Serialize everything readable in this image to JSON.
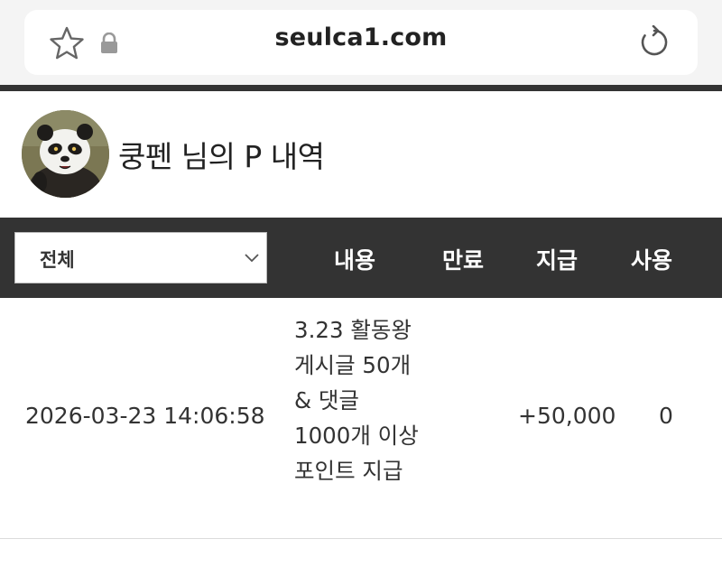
{
  "browser": {
    "url": "seulca1.com",
    "icons": [
      "star-icon",
      "lock-icon",
      "reload-icon"
    ]
  },
  "header": {
    "title": "쿵펜 님의 P 내역",
    "avatar": "panda-avatar"
  },
  "table": {
    "filter_selected": "전체",
    "columns": {
      "content": "내용",
      "expire": "만료",
      "paid": "지급",
      "used": "사용"
    },
    "rows": [
      {
        "date": "2026-03-23 14:06:58",
        "content": "3.23 활동왕 게시글 50개 & 댓글 1000개 이상 포인트 지급",
        "expire": "",
        "paid": "+50,000",
        "used": "0"
      },
      {
        "date": "",
        "content": "",
        "expire": "",
        "paid": "",
        "used": ""
      }
    ]
  },
  "colors": {
    "header_bg": "#333333",
    "browser_bg": "#f4f4f4",
    "text": "#333333"
  }
}
